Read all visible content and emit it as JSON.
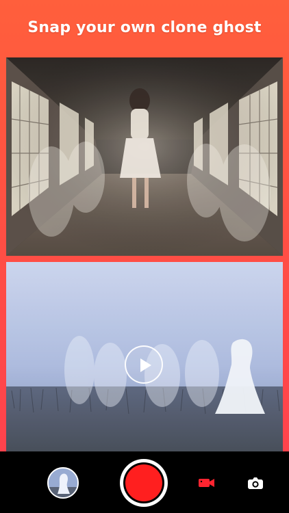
{
  "header": {
    "title": "Snap your own clone ghost"
  },
  "gallery": {
    "top_image": "corridor-ghost-clones",
    "bottom_image": "misty-field-ghost-clones"
  },
  "controls": {
    "play_icon": "play-icon",
    "thumbnail_icon": "gallery-thumbnail",
    "record_icon": "record-button-icon",
    "video_icon": "video-camera-icon",
    "photo_icon": "camera-icon"
  },
  "colors": {
    "brand_gradient_top": "#ff5f3c",
    "brand_gradient_bottom": "#ff3f4f",
    "record_red": "#ff1f1f",
    "bar_black": "#000000"
  }
}
